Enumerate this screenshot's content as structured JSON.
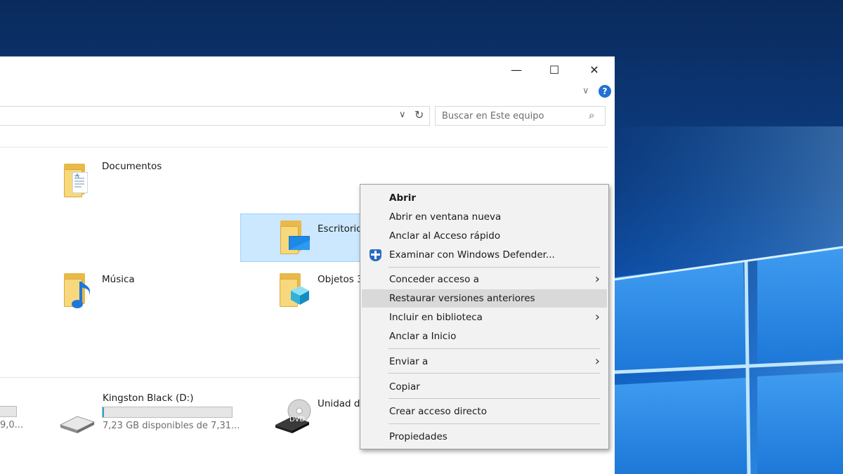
{
  "window": {
    "controls": {
      "minimize": "—",
      "maximize": "☐",
      "close": "✕"
    },
    "ribbon": {
      "expand": "∨",
      "help": "?"
    }
  },
  "address_bar": {
    "dropdown": "∨",
    "refresh": "↻"
  },
  "search": {
    "placeholder": "Buscar en Este equipo",
    "icon": "⌕"
  },
  "folders": [
    {
      "name": "Documentos",
      "icon": "documents-folder-icon"
    },
    {
      "name": "Escritorio",
      "icon": "desktop-folder-icon",
      "selected": true
    },
    {
      "name": "Música",
      "icon": "music-folder-icon"
    },
    {
      "name": "Objetos 3",
      "icon": "3d-objects-folder-icon"
    }
  ],
  "drives": [
    {
      "subtitle_partial": "9,0..."
    },
    {
      "name": "Kingston Black (D:)",
      "subtitle": "7,23 GB disponibles de 7,31...",
      "used_fraction": 0.01
    },
    {
      "name": "Unidad d",
      "icon_label": "DVD"
    }
  ],
  "context_menu": {
    "items": [
      {
        "label": "Abrir",
        "bold": true
      },
      {
        "label": "Abrir en ventana nueva"
      },
      {
        "label": "Anclar al Acceso rápido"
      },
      {
        "label": "Examinar con Windows Defender...",
        "icon": "windows-defender-shield-icon"
      },
      {
        "label": "Conceder acceso a",
        "submenu": true
      },
      {
        "label": "Restaurar versiones anteriores",
        "highlighted": true
      },
      {
        "label": "Incluir en biblioteca",
        "submenu": true
      },
      {
        "label": "Anclar a Inicio"
      },
      {
        "label": "Enviar a",
        "submenu": true
      },
      {
        "label": "Copiar"
      },
      {
        "label": "Crear acceso directo"
      },
      {
        "label": "Propiedades"
      }
    ],
    "submenu_arrow": "›"
  },
  "colors": {
    "selection_bg": "#cce8ff",
    "selection_border": "#99d1ff",
    "menu_bg": "#f2f2f2",
    "menu_highlight": "#d9d9d9",
    "desktop_blue": "#0f58b8"
  }
}
